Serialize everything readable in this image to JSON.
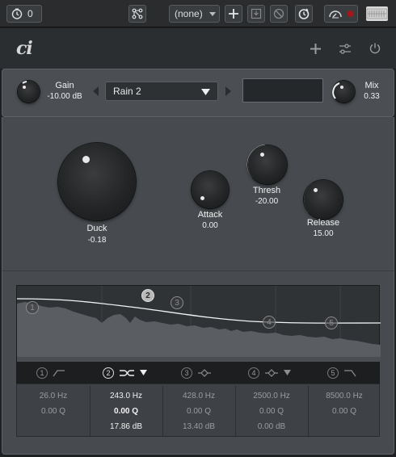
{
  "toolbar": {
    "counter_value": "0",
    "preset_select": "(none)",
    "icons": [
      "timer-icon",
      "routing-icon",
      "dropdown-arrow-icon",
      "add-icon",
      "save-icon",
      "bypass-icon",
      "tap-icon",
      "monitor-icon",
      "record-icon",
      "keyboard-icon"
    ]
  },
  "header": {
    "logo": "ci",
    "icons": [
      "add-icon",
      "settings-icon",
      "power-icon"
    ]
  },
  "top": {
    "gain_label": "Gain",
    "gain_value": "-10.00 dB",
    "preset_name": "Rain 2",
    "mix_label": "Mix",
    "mix_value": "0.33"
  },
  "knobs": {
    "duck": {
      "label": "Duck",
      "value": "-0.18"
    },
    "attack": {
      "label": "Attack",
      "value": "0.00"
    },
    "thresh": {
      "label": "Thresh",
      "value": "-20.00"
    },
    "release": {
      "label": "Release",
      "value": "15.00"
    }
  },
  "graph": {
    "nodes": [
      "1",
      "2",
      "3",
      "4",
      "5"
    ],
    "active_node": "2"
  },
  "bands": [
    {
      "num": "1",
      "freq": "26.0 Hz",
      "q": "0.00 Q",
      "gain": "",
      "active": false,
      "icon": "low-cut-icon"
    },
    {
      "num": "2",
      "freq": "243.0 Hz",
      "q": "0.00 Q",
      "gain": "17.86 dB",
      "active": true,
      "icon": "low-shelf-icon"
    },
    {
      "num": "3",
      "freq": "428.0 Hz",
      "q": "0.00 Q",
      "gain": "13.40 dB",
      "active": false,
      "icon": "peak-icon"
    },
    {
      "num": "4",
      "freq": "2500.0 Hz",
      "q": "0.00 Q",
      "gain": "0.00 dB",
      "active": false,
      "icon": "peak-icon"
    },
    {
      "num": "5",
      "freq": "8500.0 Hz",
      "q": "0.00 Q",
      "gain": "",
      "active": false,
      "icon": "high-cut-icon"
    }
  ],
  "colors": {
    "background": "#1e2022",
    "panel": "#474b4f",
    "accent": "#e8e8e8"
  }
}
